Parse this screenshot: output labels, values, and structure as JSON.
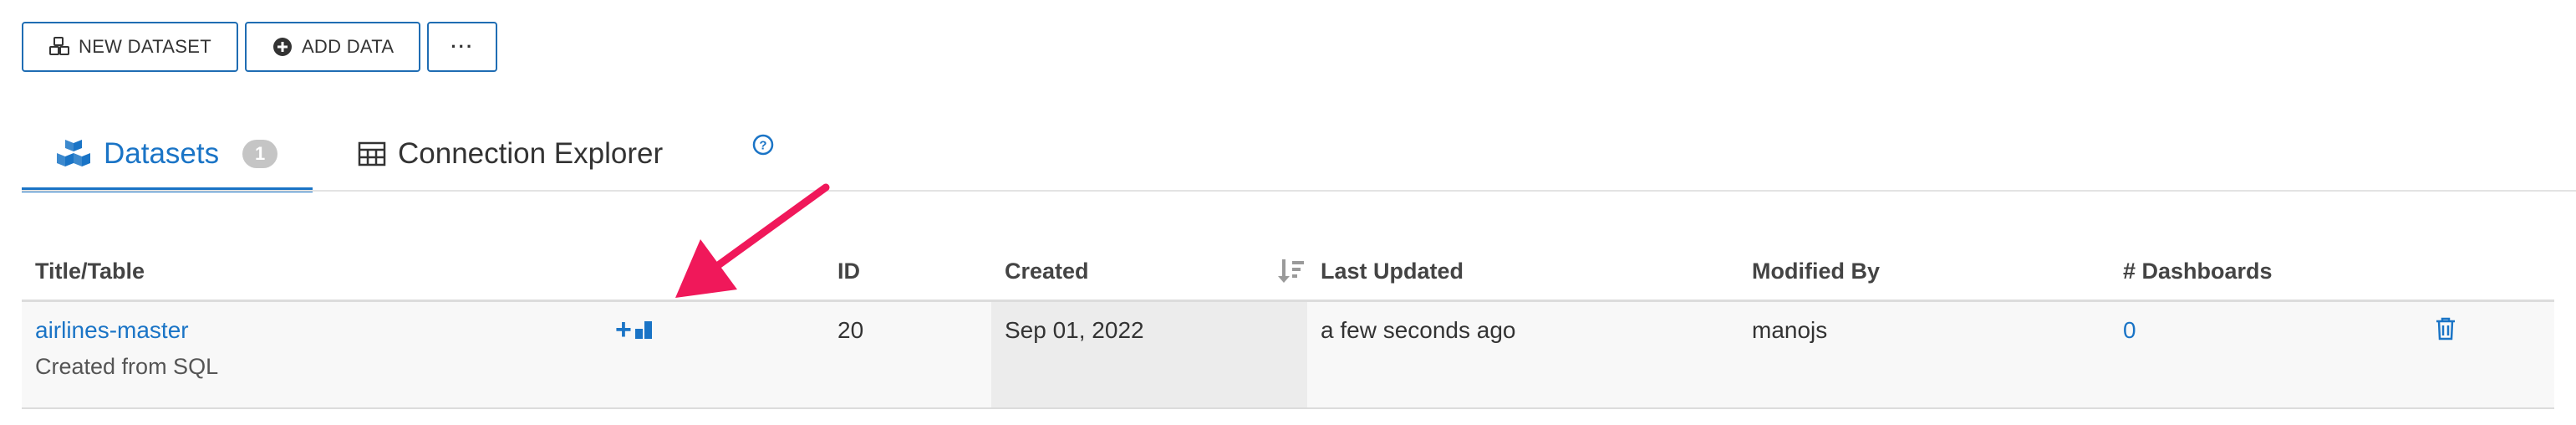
{
  "toolbar": {
    "new_dataset": "NEW DATASET",
    "add_data": "ADD DATA",
    "more": "···"
  },
  "tabs": {
    "datasets_label": "Datasets",
    "datasets_count": "1",
    "connection_explorer_label": "Connection Explorer"
  },
  "table": {
    "columns": [
      "Title/Table",
      "ID",
      "Created",
      "Last Updated",
      "Modified By",
      "# Dashboards"
    ],
    "rows": [
      {
        "title": "airlines-master",
        "subtitle": "Created from SQL",
        "id": "20",
        "created": "Sep 01, 2022",
        "last_updated": "a few seconds ago",
        "modified_by": "manojs",
        "dashboards": "0"
      }
    ]
  },
  "colors": {
    "accent": "#1a74c6",
    "annotation_arrow": "#f0185a",
    "badge": "#c5c5c5"
  },
  "icons": {
    "new_dataset": "cubes-icon",
    "add_data": "plus-circle-icon",
    "datasets_tab": "cubes-icon",
    "connection_explorer_tab": "table-icon",
    "help": "question-circle-icon",
    "sort": "sort-descending-icon",
    "new_dashboard": "plus-chart-icon",
    "delete": "trash-icon"
  }
}
